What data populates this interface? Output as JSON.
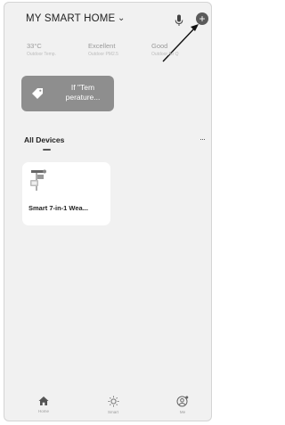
{
  "header": {
    "home_name": "MY SMART HOME",
    "chevron_icon": "chevron-down-icon",
    "mic_icon": "microphone-icon",
    "add_icon": "plus-icon",
    "add_symbol": "+"
  },
  "weather": [
    {
      "value": "33°C",
      "label": "Outdoor Temp."
    },
    {
      "value": "Excellent",
      "label": "Outdoor PM2.5"
    },
    {
      "value": "Good",
      "label": "Outdoor Air Q"
    }
  ],
  "scene": {
    "label": "If \"Tem perature...",
    "icon": "tag-icon"
  },
  "devices": {
    "section_title": "All Devices",
    "more_icon": "more-icon",
    "more_symbol": "···",
    "items": [
      {
        "name": "Smart 7-in-1 Wea...",
        "icon": "weather-station-icon"
      }
    ]
  },
  "tabs": [
    {
      "label": "Home",
      "icon": "home-icon"
    },
    {
      "label": "Smart",
      "icon": "sun-icon"
    },
    {
      "label": "Me",
      "icon": "profile-icon"
    }
  ],
  "colors": {
    "background": "#f1f1f1",
    "card": "#ffffff",
    "scene_button": "#8e8e8e",
    "text_primary": "#222222",
    "text_muted": "#9a9a9a"
  }
}
